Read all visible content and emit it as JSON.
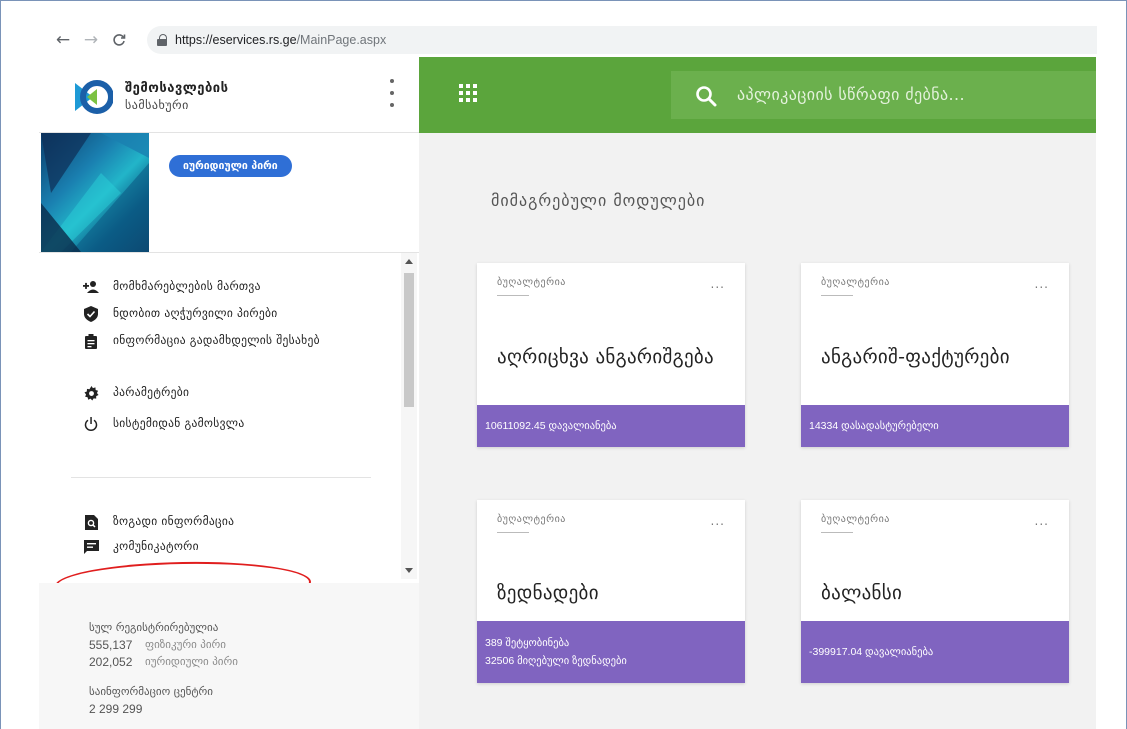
{
  "browser": {
    "url_host": "https://eservices.rs.ge",
    "url_path": "/MainPage.aspx",
    "icons": [
      "back-arrow-icon",
      "forward-arrow-icon",
      "reload-icon",
      "lock-icon"
    ]
  },
  "sidebar": {
    "logo_line1": "შემოსავლების",
    "logo_line2": "სამსახური",
    "entity_badge": "იურიდიული პირი",
    "menu": [
      {
        "label": "მომხმარებლების მართვა",
        "icon": "add-user-icon"
      },
      {
        "label": "ნდობით აღჭურვილი პირები",
        "icon": "shield-check-icon"
      },
      {
        "label": "ინფორმაცია გადამხდელის შესახებ",
        "icon": "clipboard-icon"
      },
      {
        "label": "პარამეტრები",
        "icon": "gear-icon"
      },
      {
        "label": "სისტემიდან გამოსვლა",
        "icon": "power-icon"
      },
      {
        "label": "ზოგადი ინფორმაცია",
        "icon": "document-search-icon"
      },
      {
        "label": "კომუნიკატორი",
        "icon": "chat-icon"
      }
    ],
    "stats": {
      "registered_title": "სულ რეგისტრირებულია",
      "rows": [
        {
          "value": "555,137",
          "label": "ფიზიკური პირი"
        },
        {
          "value": "202,052",
          "label": "იურიდიული პირი"
        }
      ],
      "info_center_title": "საინფორმაციო ცენტრი",
      "info_center_value": "2 299 299"
    }
  },
  "topbar": {
    "search_placeholder": "აპლიკაციის სწრაფი ძებნა...",
    "colors": {
      "bar": "#5ba53c",
      "search": "#6bb04d"
    }
  },
  "main": {
    "section_title": "მიმაგრებული მოდულები",
    "cards": [
      {
        "category": "ბუღალტერია",
        "more": "...",
        "title": "აღრიცხვა ანგარიშგება",
        "footer": [
          "10611092.45 დავალიანება"
        ]
      },
      {
        "category": "ბუღალტერია",
        "more": "...",
        "title": "ანგარიშ-ფაქტურები",
        "footer": [
          "14334 დასადასტურებელი"
        ]
      },
      {
        "category": "ბუღალტერია",
        "more": "...",
        "title": "ზედნადები",
        "footer": [
          "389 შეტყობინება",
          "32506 მიღებული ზედნადები"
        ]
      },
      {
        "category": "ბუღალტერია",
        "more": "...",
        "title": "ბალანსი",
        "footer": [
          "-399917.04 დავალიანება"
        ]
      }
    ],
    "colors": {
      "card_footer": "#8064c0"
    }
  }
}
